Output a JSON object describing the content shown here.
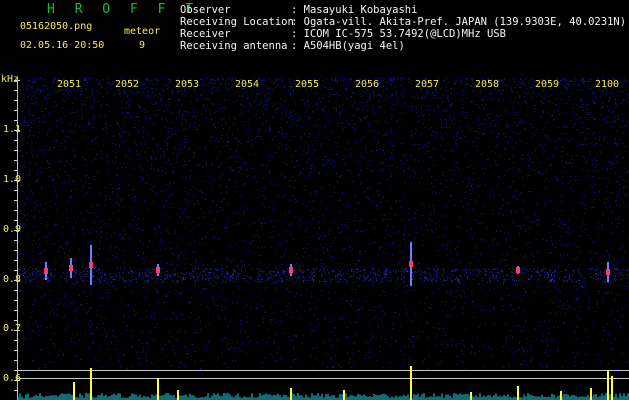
{
  "app": {
    "title": "H R O F F T",
    "filename": "05162050.png",
    "datetime": "02.05.16 20:50",
    "meteor_label": "meteor",
    "meteor_count": "9"
  },
  "info": {
    "rows": [
      {
        "label": "Observer",
        "value": ": Masayuki Kobayashi"
      },
      {
        "label": "Receiving Location",
        "value": ": Ogata-vill. Akita-Pref. JAPAN (139.9303E, 40.0231N)"
      },
      {
        "label": "Receiver",
        "value": ": ICOM IC-575 53.7492(@LCD)MHz USB"
      },
      {
        "label": "Receiving antenna",
        "value": ": A504HB(yagi 4el)"
      }
    ]
  },
  "axis": {
    "unit": "kHz",
    "y_labels": [
      "1.1",
      "1.0",
      "0.9",
      "0.8",
      "0.7",
      "0.6"
    ],
    "minute_labels": [
      "2051",
      "2052",
      "2053",
      "2054",
      "2055",
      "2056",
      "2057",
      "2058",
      "2059",
      "2100"
    ]
  },
  "colors": {
    "background": "#000000",
    "noise": "#1a1aa8",
    "label": "#f2ec5a",
    "title": "#19b832",
    "header": "#f4f4f4",
    "meteor": "#ff3b6b",
    "peak": "#ffff40",
    "baseline": "#2ad6e6"
  }
}
